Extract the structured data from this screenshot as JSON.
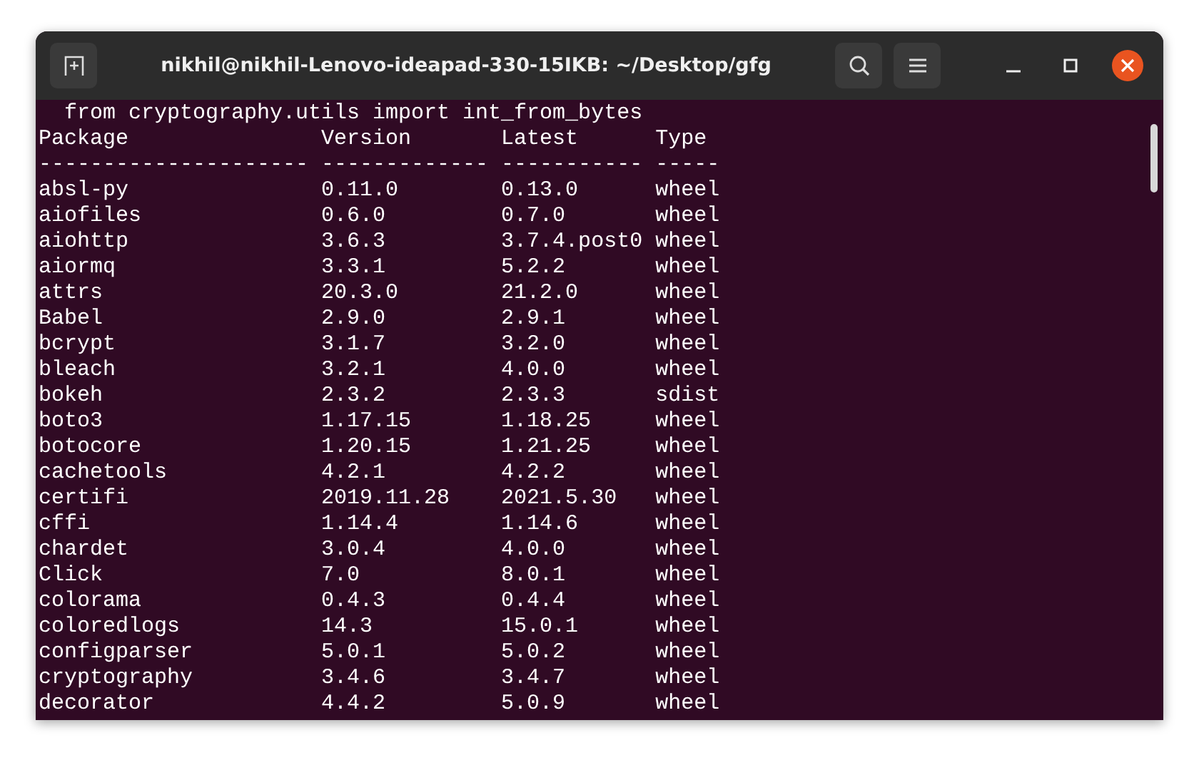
{
  "window": {
    "title": "nikhil@nikhil-Lenovo-ideapad-330-15IKB: ~/Desktop/gfg"
  },
  "terminal": {
    "lines": [
      "  from cryptography.utils import int_from_bytes",
      "Package               Version       Latest      Type",
      "--------------------- ------------- ----------- -----",
      "absl-py               0.11.0        0.13.0      wheel",
      "aiofiles              0.6.0         0.7.0       wheel",
      "aiohttp               3.6.3         3.7.4.post0 wheel",
      "aiormq                3.3.1         5.2.2       wheel",
      "attrs                 20.3.0        21.2.0      wheel",
      "Babel                 2.9.0         2.9.1       wheel",
      "bcrypt                3.1.7         3.2.0       wheel",
      "bleach                3.2.1         4.0.0       wheel",
      "bokeh                 2.3.2         2.3.3       sdist",
      "boto3                 1.17.15       1.18.25     wheel",
      "botocore              1.20.15       1.21.25     wheel",
      "cachetools            4.2.1         4.2.2       wheel",
      "certifi               2019.11.28    2021.5.30   wheel",
      "cffi                  1.14.4        1.14.6      wheel",
      "chardet               3.0.4         4.0.0       wheel",
      "Click                 7.0           8.0.1       wheel",
      "colorama              0.4.3         0.4.4       wheel",
      "coloredlogs           14.3          15.0.1      wheel",
      "configparser          5.0.1         5.0.2       wheel",
      "cryptography          3.4.6         3.4.7       wheel",
      "decorator             4.4.2         5.0.9       wheel"
    ]
  }
}
